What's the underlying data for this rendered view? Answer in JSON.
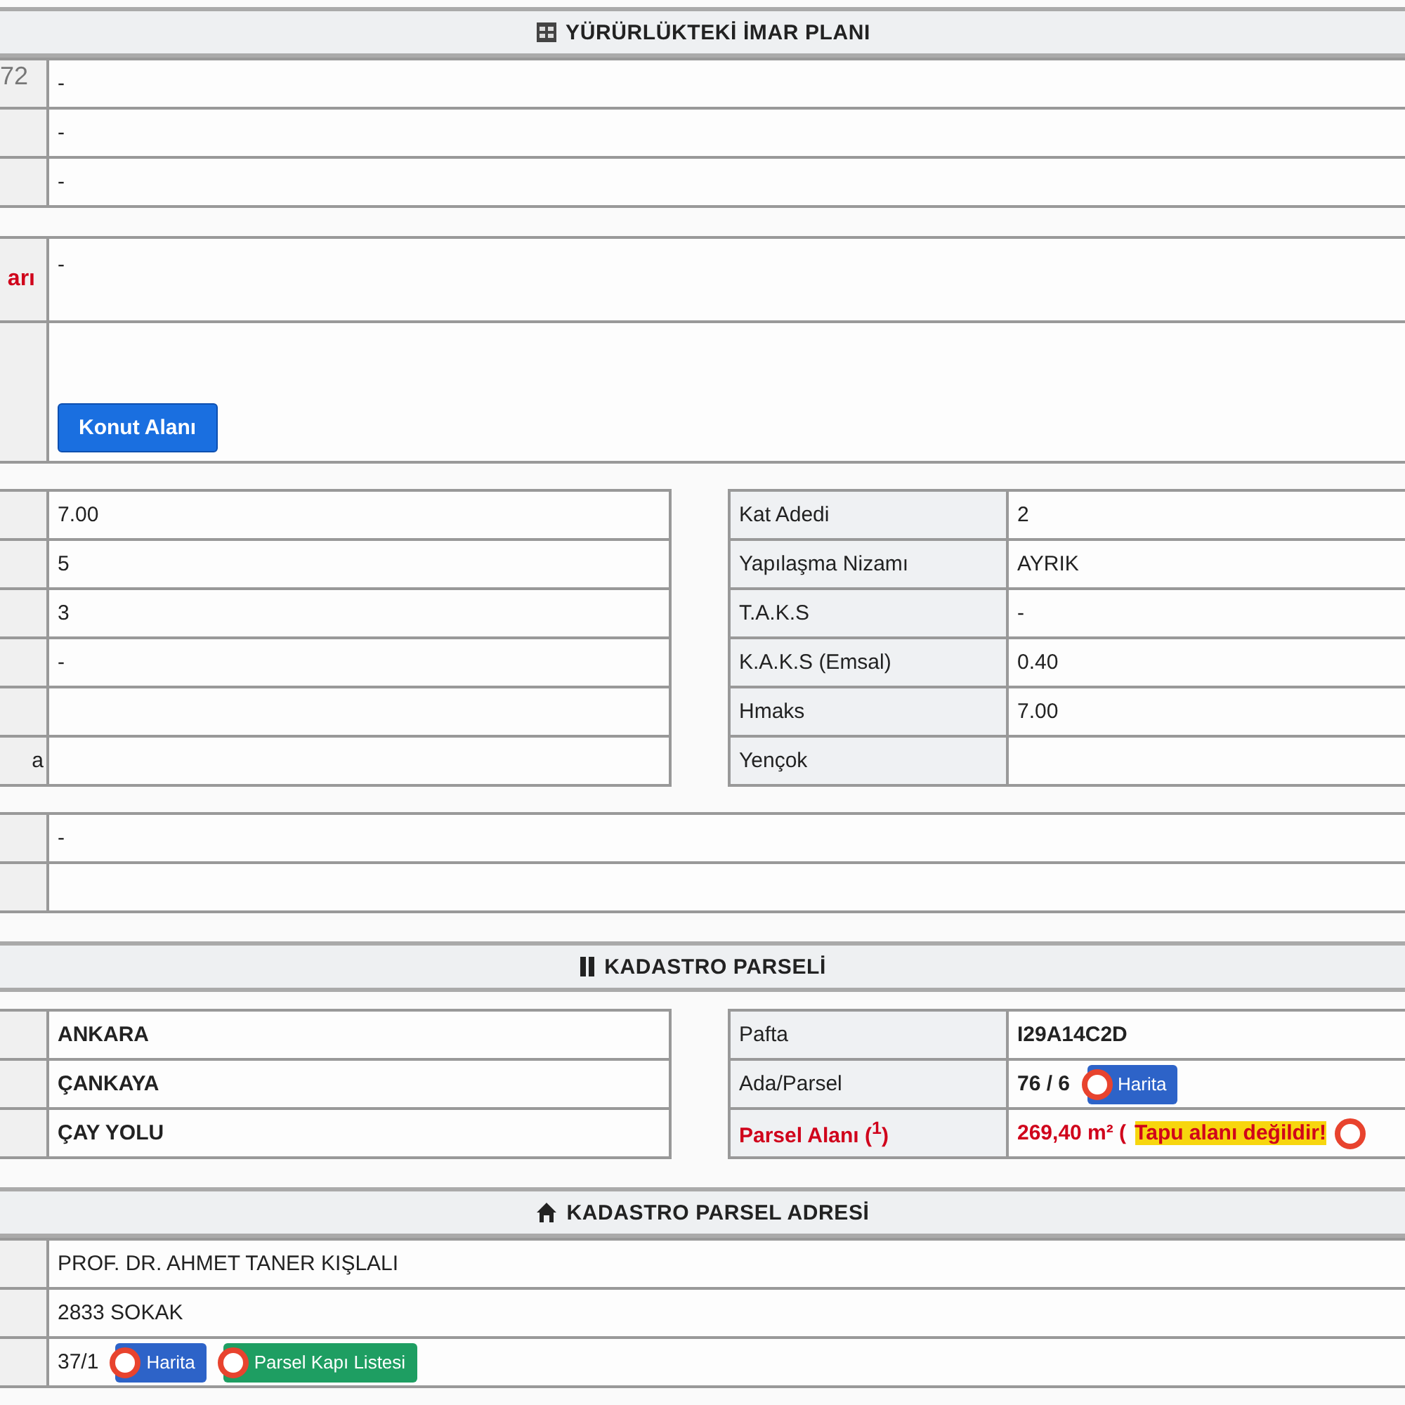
{
  "fragment": "72",
  "imar_plani": {
    "title": "YÜRÜRLÜKTEKİ İMAR PLANI",
    "rows": [
      {
        "value": "-"
      },
      {
        "value": "-"
      },
      {
        "value": "-"
      }
    ]
  },
  "plan_notes": [
    {
      "kind": "text",
      "label": "arı",
      "value": "-"
    },
    {
      "kind": "button",
      "button": "Konut Alanı"
    }
  ],
  "paired_rows": [
    {
      "left_value": "7.00",
      "label": "Kat Adedi",
      "value": "2"
    },
    {
      "left_value": "5",
      "label": "Yapılaşma Nizamı",
      "value": "AYRIK"
    },
    {
      "left_value": "3",
      "label": "T.A.K.S",
      "value": "-"
    },
    {
      "left_value": "-",
      "label": "K.A.K.S (Emsal)",
      "value": "0.40"
    },
    {
      "label": "Hmaks",
      "value": "7.00"
    },
    {
      "left_label": "a",
      "label": "Yençok"
    }
  ],
  "extra_rows": [
    {
      "value": "-"
    }
  ],
  "kadastro_parseli": {
    "title": "KADASTRO PARSELİ",
    "left_rows": [
      {
        "value": "ANKARA"
      },
      {
        "value": "ÇANKAYA"
      },
      {
        "value": "ÇAY YOLU"
      }
    ],
    "right_rows": [
      {
        "kind": "text",
        "label": "Pafta",
        "value": "I29A14C2D"
      },
      {
        "kind": "map",
        "label": "Ada/Parsel",
        "value": "76 / 6",
        "button": "Harita"
      },
      {
        "kind": "area",
        "label": "Parsel Alanı ($^{1}$)",
        "value": "269,40 m² (",
        "note": "Tapu alanı değildir!"
      }
    ]
  },
  "adres": {
    "title": "KADASTRO PARSEL ADRESİ",
    "rows": [
      {
        "value": "PROF. DR. AHMET TANER KIŞLALI"
      },
      {
        "value": "2833 SOKAK"
      },
      {
        "value": "37/1",
        "buttons": [
          {
            "label": "Harita",
            "color": "#2d63c8"
          },
          {
            "label": "Parsel Kapı Listesi",
            "color": "#1e9e62"
          }
        ]
      }
    ]
  }
}
